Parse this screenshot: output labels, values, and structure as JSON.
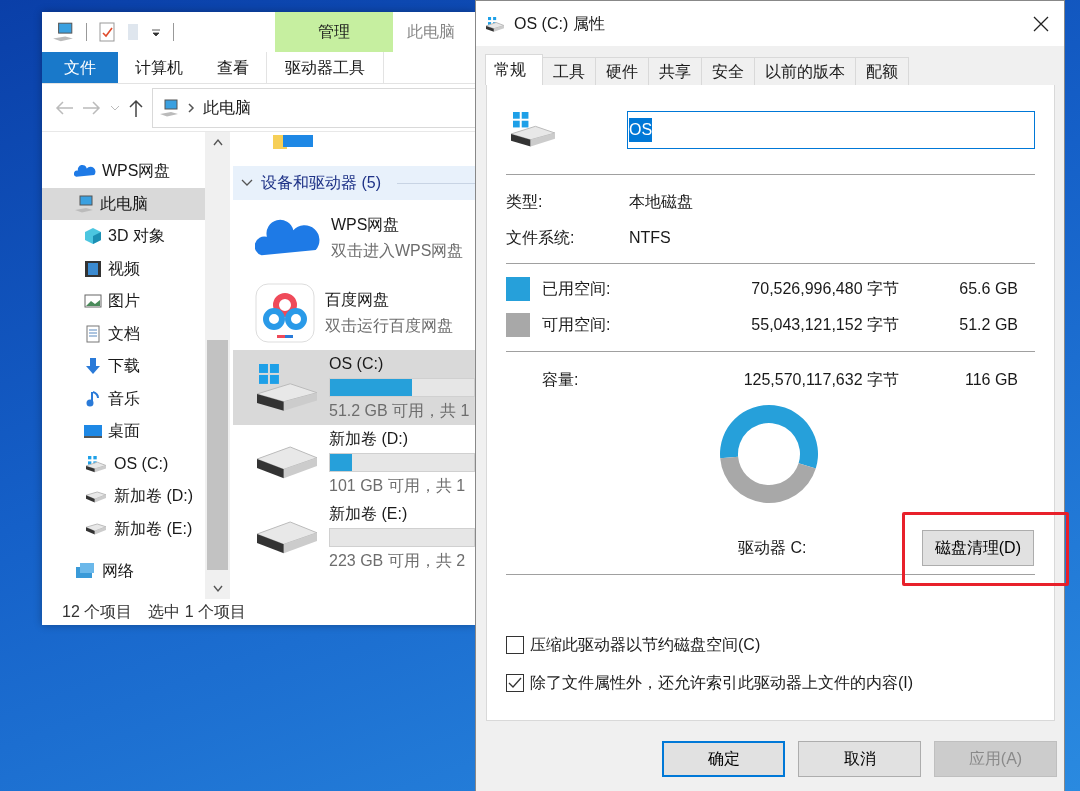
{
  "explorer": {
    "window_title": "此电脑",
    "ribbon_tabs": [
      {
        "label": "文件",
        "kind": "file"
      },
      {
        "label": "计算机",
        "kind": "plain"
      },
      {
        "label": "查看",
        "kind": "plain"
      },
      {
        "label": "驱动器工具",
        "kind": "contextual",
        "group": "管理"
      }
    ],
    "address": {
      "path": "此电脑"
    },
    "nav": [
      {
        "label": "WPS网盘",
        "selected": false
      },
      {
        "label": "此电脑",
        "selected": true,
        "children": [
          {
            "label": "3D 对象",
            "selected": false
          },
          {
            "label": "视频",
            "selected": false
          },
          {
            "label": "图片",
            "selected": false
          },
          {
            "label": "文档",
            "selected": false
          },
          {
            "label": "下载",
            "selected": false
          },
          {
            "label": "音乐",
            "selected": false
          },
          {
            "label": "桌面",
            "selected": false
          },
          {
            "label": "OS (C:)",
            "selected": false
          },
          {
            "label": "新加卷 (D:)",
            "selected": false
          },
          {
            "label": "新加卷 (E:)",
            "selected": false
          }
        ]
      },
      {
        "label": "网络",
        "selected": false
      }
    ],
    "group": {
      "label": "设备和驱动器 (5)",
      "expanded": true
    },
    "items": [
      {
        "kind": "app",
        "name": "WPS网盘",
        "detail": "双击进入WPS网盘",
        "selected": false
      },
      {
        "kind": "app",
        "name": "百度网盘",
        "detail": "双击运行百度网盘",
        "selected": false
      },
      {
        "kind": "drive",
        "name": "OS (C:)",
        "level": 0.57,
        "detail": "51.2 GB 可用，共 1",
        "selected": true
      },
      {
        "kind": "drive",
        "name": "新加卷 (D:)",
        "level": 0.15,
        "detail": "101 GB 可用，共 1",
        "selected": false
      },
      {
        "kind": "drive",
        "name": "新加卷 (E:)",
        "level": 0.0,
        "detail": "223 GB 可用，共 2",
        "selected": false
      }
    ],
    "status_bar": [
      "12 个项目",
      "选中 1 个项目"
    ]
  },
  "dialog": {
    "title": "OS (C:) 属性",
    "tabs": [
      {
        "label": "常规",
        "selected": true
      },
      {
        "label": "工具",
        "selected": false
      },
      {
        "label": "硬件",
        "selected": false
      },
      {
        "label": "共享",
        "selected": false
      },
      {
        "label": "安全",
        "selected": false
      },
      {
        "label": "以前的版本",
        "selected": false
      },
      {
        "label": "配额",
        "selected": false
      }
    ],
    "name_field": {
      "value": "OS",
      "text_selected": true
    },
    "info": [
      {
        "label": "类型:",
        "value": "本地磁盘"
      },
      {
        "label": "文件系统:",
        "value": "NTFS"
      }
    ],
    "space": [
      {
        "label": "已用空间:",
        "bytes": "70,526,996,480 字节",
        "size": "65.6 GB",
        "color": "#26a0da"
      },
      {
        "label": "可用空间:",
        "bytes": "55,043,121,152 字节",
        "size": "51.2 GB",
        "color": "#a8a8a8"
      }
    ],
    "capacity": {
      "label": "容量:",
      "bytes": "125,570,117,632 字节",
      "size": "116 GB"
    },
    "chart_data": {
      "type": "donut",
      "values": [
        56.2,
        43.8
      ]
    },
    "drive_label": "驱动器 C:",
    "cleanup_button": {
      "label": "磁盘清理(D)",
      "highlighted": true
    },
    "options": [
      {
        "label": "压缩此驱动器以节约磁盘空间(C)",
        "checked": false
      },
      {
        "label": "除了文件属性外，还允许索引此驱动器上文件的内容(I)",
        "checked": true
      }
    ],
    "buttons": [
      {
        "label": "确定",
        "default": true,
        "disabled": false
      },
      {
        "label": "取消",
        "default": false,
        "disabled": false
      },
      {
        "label": "应用(A)",
        "default": false,
        "disabled": true
      }
    ]
  }
}
